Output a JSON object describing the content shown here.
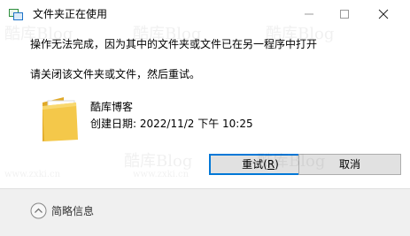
{
  "window": {
    "title": "文件夹正在使用",
    "icon": "folder-transfer-icon",
    "controls": [
      "minimize-icon",
      "maximize-icon",
      "close-icon"
    ]
  },
  "message": {
    "line1": "操作无法完成，因为其中的文件夹或文件已在另一程序中打开",
    "line2": "请关闭该文件夹或文件，然后重试。"
  },
  "file": {
    "icon": "folder-icon",
    "name": "酷库博客",
    "created": "创建日期: 2022/11/2 下午 10:25"
  },
  "buttons": {
    "retry_label": "重试(",
    "retry_key": "R",
    "retry_end": ")",
    "cancel_label": "取消"
  },
  "footer": {
    "toggle_label": "简略信息",
    "toggle_icon": "chevron-up-icon"
  },
  "watermark": {
    "brand": "酷库Blog",
    "url": "www.zxki.cn"
  },
  "colors": {
    "accent": "#0078d7",
    "folder": "#f4c84a",
    "footer_bg": "#f0f0f0"
  }
}
